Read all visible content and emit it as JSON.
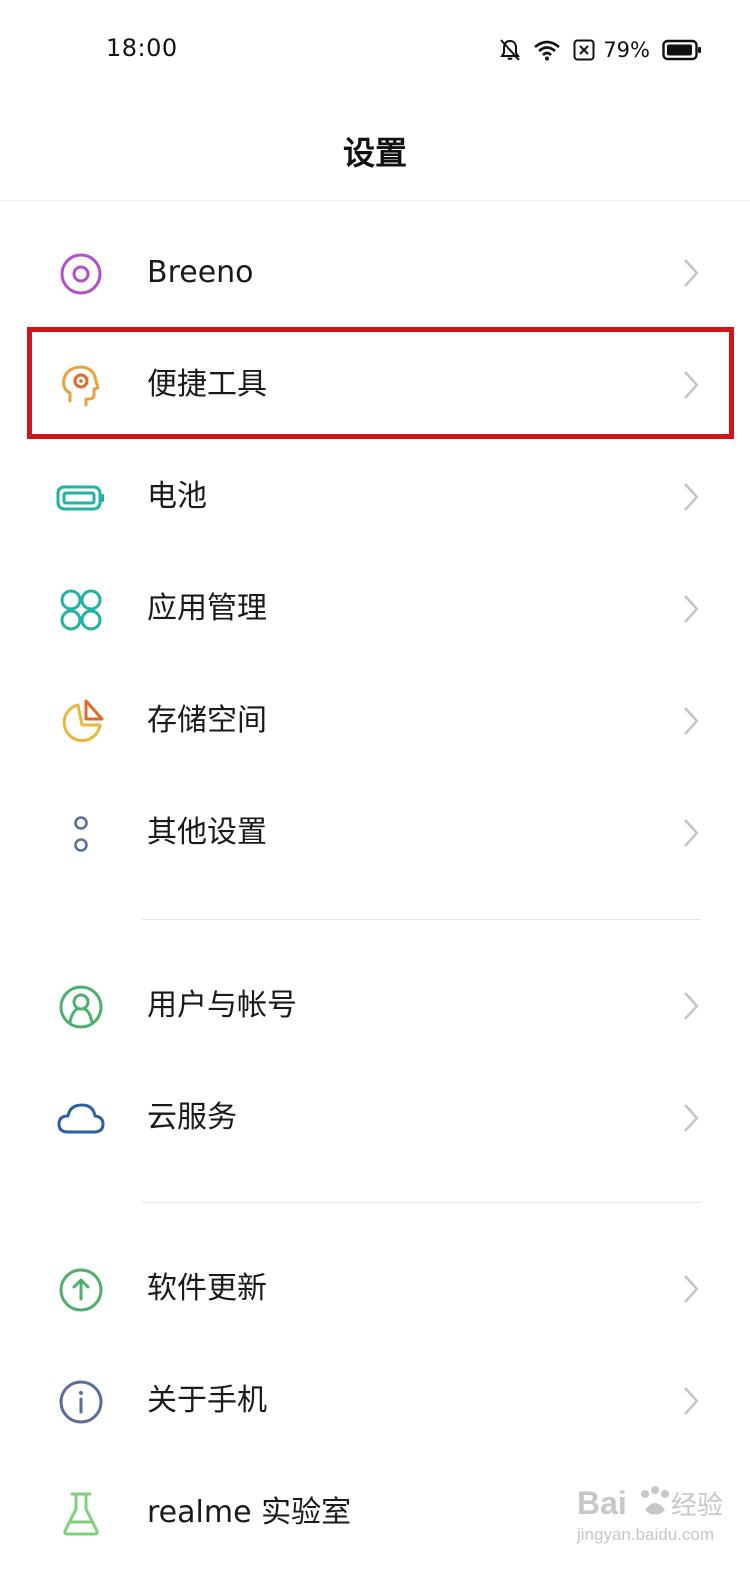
{
  "status_bar": {
    "time": "18:00",
    "battery_percent": "79%",
    "icons": [
      "bell-off-icon",
      "wifi-icon",
      "sim-x-icon",
      "battery-icon"
    ]
  },
  "header": {
    "title": "设置"
  },
  "settings": {
    "items": [
      {
        "label": "Breeno",
        "icon": "breeno-icon",
        "color": "#b24fc9"
      },
      {
        "label": "便捷工具",
        "icon": "convenience-tools-icon",
        "color": "#e8a33d"
      },
      {
        "label": "电池",
        "icon": "battery-icon",
        "color": "#1fb3a0"
      },
      {
        "label": "应用管理",
        "icon": "app-grid-icon",
        "color": "#1fb3a0"
      },
      {
        "label": "存储空间",
        "icon": "storage-pie-icon",
        "color": "#e8b83d"
      },
      {
        "label": "其他设置",
        "icon": "dots-icon",
        "color": "#5b6e9a"
      },
      {
        "label": "用户与帐号",
        "icon": "user-icon",
        "color": "#4caf6d"
      },
      {
        "label": "云服务",
        "icon": "cloud-icon",
        "color": "#2f5ea8"
      },
      {
        "label": "软件更新",
        "icon": "update-arrow-icon",
        "color": "#4caf6d"
      },
      {
        "label": "关于手机",
        "icon": "info-icon",
        "color": "#5b6e9a"
      },
      {
        "label": "realme 实验室",
        "icon": "flask-icon",
        "color": "#7ed07a"
      }
    ]
  },
  "annotation": {
    "highlight_color": "#d0141c"
  },
  "watermark": {
    "text_top": "Bai 经验",
    "text_bottom": "jingyan.baidu.com"
  }
}
